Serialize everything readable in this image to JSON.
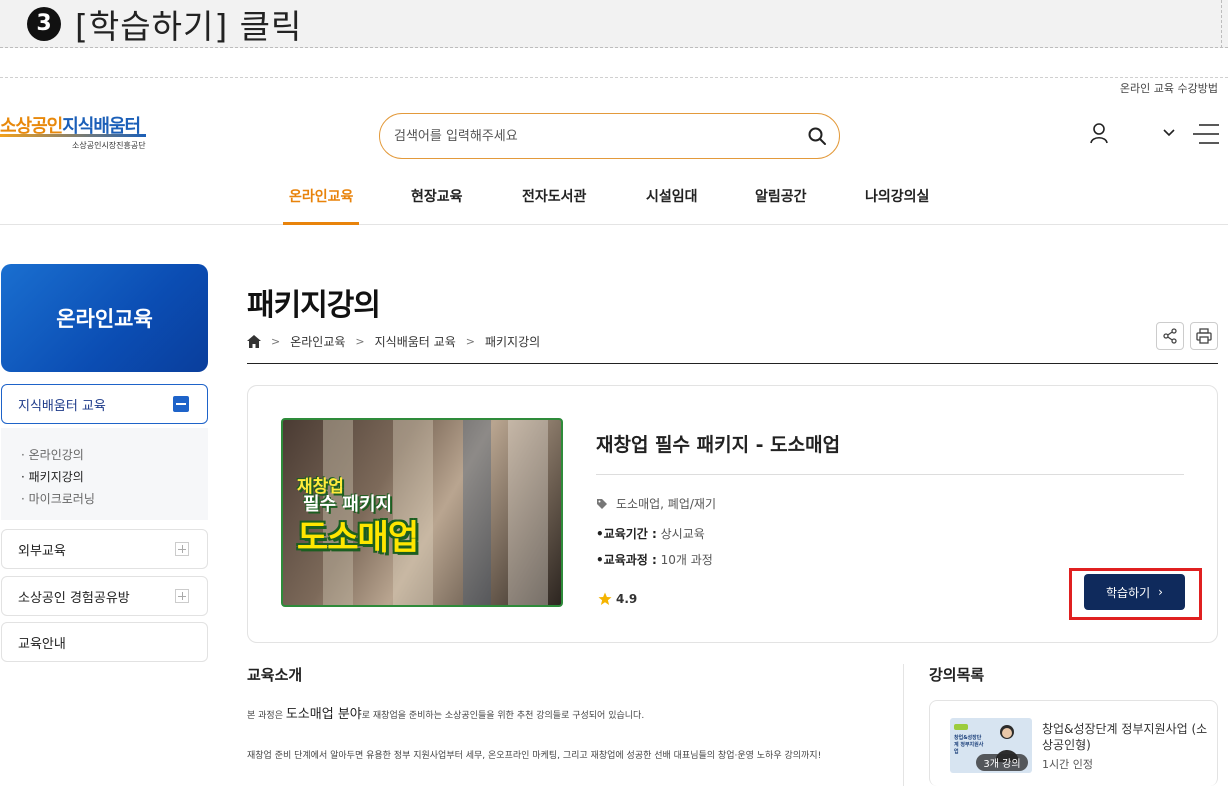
{
  "instruction": {
    "step": "3",
    "text": "[학습하기] 클릭"
  },
  "header": {
    "guide_link": "온라인 교육 수강방법",
    "logo": {
      "main_orange": "소상공인",
      "main_blue": "지식배움터",
      "sub": "소상공인시장진흥공단"
    },
    "search": {
      "placeholder": "검색어를 입력해주세요",
      "value": ""
    }
  },
  "gnb": {
    "items": [
      {
        "label": "온라인교육",
        "active": true
      },
      {
        "label": "현장교육"
      },
      {
        "label": "전자도서관"
      },
      {
        "label": "시설임대"
      },
      {
        "label": "알림공간"
      },
      {
        "label": "나의강의실"
      }
    ]
  },
  "sidebar": {
    "hero": "온라인교육",
    "group": "지식배움터 교육",
    "sub_items": [
      "· 온라인강의",
      "· 패키지강의",
      "· 마이크로러닝"
    ],
    "items": [
      "외부교육",
      "소상공인 경험공유방",
      "교육안내"
    ]
  },
  "content": {
    "page_title": "패키지강의",
    "breadcrumb": [
      "온라인교육",
      "지식배움터 교육",
      "패키지강의"
    ],
    "card": {
      "thumb_text": [
        "재창업",
        "필수 패키지",
        "도소매업"
      ],
      "title": "재창업 필수 패키지 - 도소매업",
      "tags": "도소매업, 폐업/재기",
      "period_label": "•교육기간 :",
      "period_value": " 상시교육",
      "course_label": "•교육과정 :",
      "course_value": " 10개 과정",
      "rating": "4.9",
      "learn_button": "학습하기",
      "learn_chevron": "›"
    },
    "intro": {
      "title": "교육소개",
      "p1_a": "본 과정은 ",
      "p1_big": "도소매업 분야",
      "p1_b": "로 재창업을 준비하는 소상공인들을 위한 추천 강의들로 구성되어 있습니다.",
      "p2": "재창업 준비 단계에서 알아두면 유용한 정부 지원사업부터 세무, 온오프라인 마케팅, 그리고 재창업에 성공한 선배 대표님들의 창업·운영 노하우 강의까지!"
    },
    "lecture_list": {
      "title": "강의목록",
      "items": [
        {
          "title": "창업&성장단계 정부지원사업 (소상공인형)",
          "sub": "1시간 인정",
          "count": "3개 강의",
          "thumb_label": "창업&성장단계 정부지원사업"
        }
      ]
    }
  },
  "colors": {
    "accent_orange": "#e8830b",
    "brand_blue": "#1b5fb8",
    "button_navy": "#0f2a5c",
    "highlight_red": "#e02020"
  }
}
